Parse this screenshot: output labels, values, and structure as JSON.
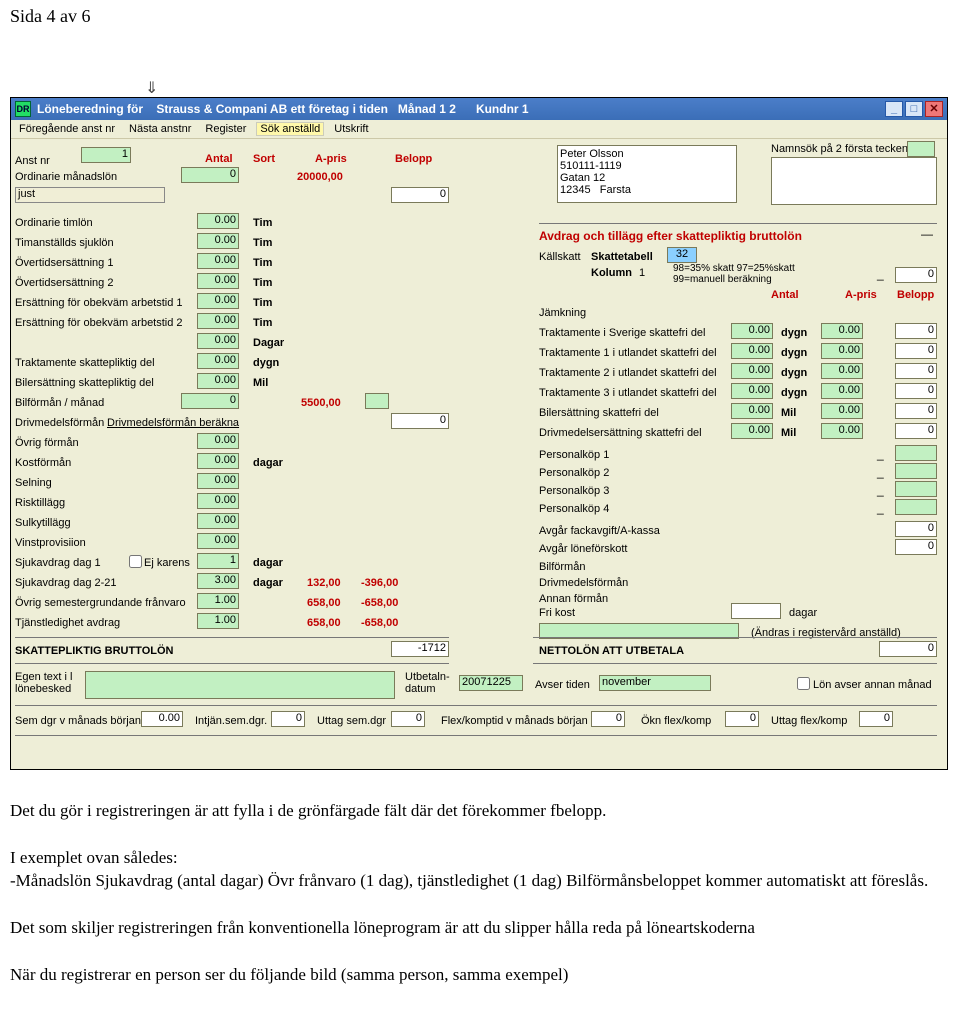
{
  "page_header": "Sida 4 av 6",
  "window": {
    "icon_text": "DR",
    "title": "Löneberedning för    Strauss & Compani AB ett företag i tiden   Månad 1 2      Kundnr 1"
  },
  "menu": {
    "prev": "Föregående anst nr",
    "next": "Nästa anstnr",
    "register": "Register",
    "search": "Sök anställd",
    "print": "Utskrift"
  },
  "header_cols": {
    "antal": "Antal",
    "sort": "Sort",
    "apris": "A-pris",
    "belopp": "Belopp"
  },
  "top": {
    "anst_nr_lbl": "Anst nr",
    "anst_nr_val": "1",
    "ordinarie_lbl": "Ordinarie månadslön",
    "ordinarie_val": "0",
    "ordinarie_apris": "20000,00",
    "just_lbl": "just",
    "just_belopp": "0",
    "person_box": "Peter Olsson\n510111-1119\nGatan 12\n12345   Farsta",
    "namnsok_lbl": "Namnsök på 2 första tecken"
  },
  "left_rows": [
    {
      "label": "Ordinarie timlön",
      "val": "0.00",
      "sort": "Tim"
    },
    {
      "label": "Timanställds sjuklön",
      "val": "0.00",
      "sort": "Tim"
    },
    {
      "label": "Övertidsersättning 1",
      "val": "0.00",
      "sort": "Tim"
    },
    {
      "label": "Övertidsersättning 2",
      "val": "0.00",
      "sort": "Tim"
    },
    {
      "label": "Ersättning för obekväm arbetstid 1",
      "val": "0.00",
      "sort": "Tim"
    },
    {
      "label": "Ersättning för obekväm arbetstid 2",
      "val": "0.00",
      "sort": "Tim"
    },
    {
      "label": "",
      "val": "0.00",
      "sort": "Dagar"
    },
    {
      "label": "Traktamente skattepliktig del",
      "val": "0.00",
      "sort": "dygn"
    },
    {
      "label": "Bilersättning skattepliktig del",
      "val": "0.00",
      "sort": "Mil"
    }
  ],
  "bilforman": {
    "label": "Bilförmån / månad",
    "val": "0",
    "apris": "5500,00"
  },
  "drivmedel": {
    "label": "Drivmedelsförmån",
    "link": "Drivmedelsförmån beräkna",
    "belopp": "0"
  },
  "left_rows2": [
    {
      "label": "Övrig förmån",
      "val": "0.00",
      "sort": ""
    },
    {
      "label": "Kostförmån",
      "val": "0.00",
      "sort": "dagar"
    },
    {
      "label": "Selning",
      "val": "0.00",
      "sort": ""
    },
    {
      "label": "Risktillägg",
      "val": "0.00",
      "sort": ""
    },
    {
      "label": "Sulkytillägg",
      "val": "0.00",
      "sort": ""
    },
    {
      "label": "Vinstprovisiion",
      "val": "0.00",
      "sort": ""
    }
  ],
  "sjuk1": {
    "label": "Sjukavdrag dag 1",
    "chk_lbl": "Ej karens",
    "val": "1",
    "sort": "dagar"
  },
  "sjuk2": {
    "label": "Sjukavdrag dag 2-21",
    "val": "3.00",
    "sort": "dagar",
    "apris": "132,00",
    "belopp": "-396,00"
  },
  "ovrig_sem": {
    "label": "Övrig semestergrundande frånvaro",
    "val": "1.00",
    "apris": "658,00",
    "belopp": "-658,00"
  },
  "tjled": {
    "label": "Tjänstledighet avdrag",
    "val": "1.00",
    "apris": "658,00",
    "belopp": "-658,00"
  },
  "brutto": {
    "label": "SKATTEPLIKTIG BRUTTOLÖN",
    "val": "-1712"
  },
  "right": {
    "section_title": "Avdrag och tillägg efter skattepliktig  bruttolön",
    "kallskatt_lbl": "Källskatt",
    "tabell_lbl": "Skattetabell",
    "tabell_val": "32",
    "kolumn_lbl": "Kolumn",
    "kolumn_val": "1",
    "kolumn_hint": "98=35% skatt 97=25%skatt\n99=manuell beräkning",
    "belopp_top": "0",
    "antal": "Antal",
    "apris": "A-pris",
    "belopp": "Belopp",
    "jamkning_lbl": "Jämkning"
  },
  "right_rows": [
    {
      "label": "Traktamente i Sverige skattefri del",
      "antal": "0.00",
      "sort": "dygn",
      "apris": "0.00",
      "belopp": "0"
    },
    {
      "label": "Traktamente 1 i utlandet skattefri del",
      "antal": "0.00",
      "sort": "dygn",
      "apris": "0.00",
      "belopp": "0"
    },
    {
      "label": "Traktamente 2 i utlandet skattefri del",
      "antal": "0.00",
      "sort": "dygn",
      "apris": "0.00",
      "belopp": "0"
    },
    {
      "label": "Traktamente 3 i utlandet skattefri del",
      "antal": "0.00",
      "sort": "dygn",
      "apris": "0.00",
      "belopp": "0"
    },
    {
      "label": "Bilersättning skattefri del",
      "antal": "0.00",
      "sort": "Mil",
      "apris": "0.00",
      "belopp": "0"
    },
    {
      "label": "Drivmedelsersättning skattefri del",
      "antal": "0.00",
      "sort": "Mil",
      "apris": "0.00",
      "belopp": "0"
    }
  ],
  "personkop": [
    {
      "label": "Personalköp 1"
    },
    {
      "label": "Personalköp 2"
    },
    {
      "label": "Personalköp 3"
    },
    {
      "label": "Personalköp 4"
    }
  ],
  "avgar": [
    {
      "label": "Avgår fackavgift/A-kassa",
      "belopp": "0"
    },
    {
      "label": "Avgår löneförskott",
      "belopp": "0"
    }
  ],
  "forman_list": [
    {
      "label": "Bilförmån"
    },
    {
      "label": "Drivmedelsförmån"
    },
    {
      "label": "Annan förmån"
    }
  ],
  "frikost": {
    "label": "Fri kost",
    "sort": "dagar"
  },
  "andras": "(Ändras i registervård anställd)",
  "netto": {
    "label": "NETTOLÖN ATT UTBETALA",
    "val": "0"
  },
  "footer": {
    "egen_text_lbl": "Egen text i l\nlönebesked",
    "utbet_lbl": "Utbetaln-\ndatum",
    "utbet_val": "20071225",
    "avser_lbl": "Avser tiden",
    "avser_val": "november",
    "lon_annan_lbl": "Lön avser annan månad",
    "row2": {
      "sem_borjan_lbl": "Sem dgr v månads början",
      "sem_borjan_val": "0.00",
      "intjan_lbl": "Intjän.sem.dgr.",
      "intjan_val": "0",
      "uttag_lbl": "Uttag sem.dgr",
      "uttag_val": "0",
      "flex_borjan_lbl": "Flex/komptid v månads början",
      "flex_borjan_val": "0",
      "okn_lbl": "Ökn flex/komp",
      "okn_val": "0",
      "uttag_flex_lbl": "Uttag flex/komp",
      "uttag_flex_val": "0"
    }
  },
  "bodytext": {
    "p1": "Det du gör i registreringen är att fylla i de grönfärgade fält där det förekommer fbelopp.",
    "p2": "I exemplet ovan således:\n-Månadslön Sjukavdrag (antal dagar) Övr frånvaro (1 dag), tjänstledighet (1 dag) Bilförmånsbeloppet kommer automatiskt att föreslås.",
    "p3": "Det som skiljer registreringen från konventionella löneprogram är att du slipper hålla reda på löneartskoderna",
    "p4": "När du registrerar en person ser du följande bild (samma person, samma exempel)"
  }
}
